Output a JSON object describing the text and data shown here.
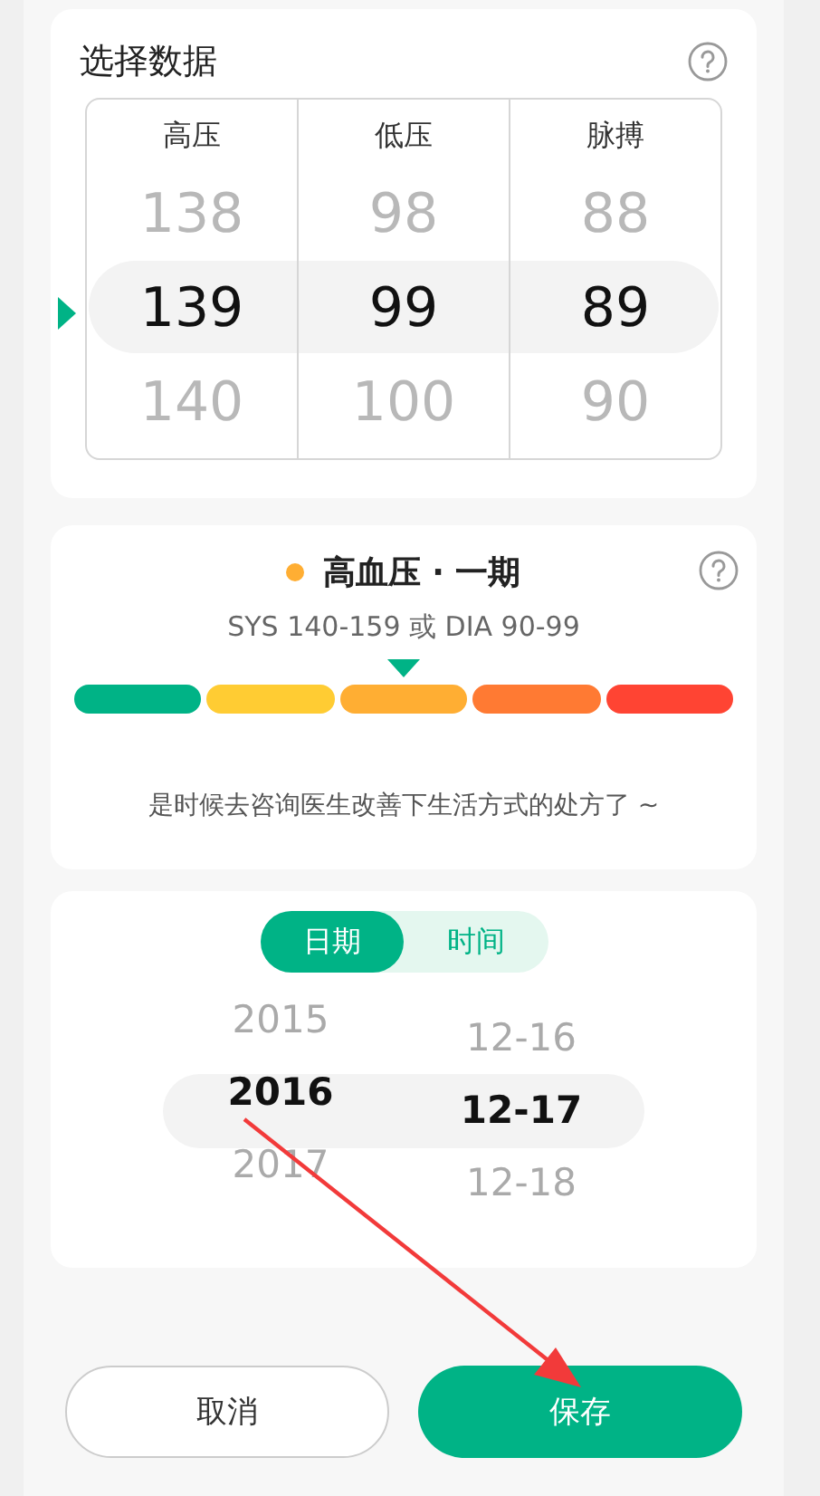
{
  "data_card": {
    "title": "选择数据",
    "columns": [
      {
        "label": "高压",
        "values": [
          {
            "text": "138",
            "selected": false
          },
          {
            "text": "139",
            "selected": true
          },
          {
            "text": "140",
            "selected": false
          }
        ]
      },
      {
        "label": "低压",
        "values": [
          {
            "text": "98",
            "selected": false
          },
          {
            "text": "99",
            "selected": true
          },
          {
            "text": "100",
            "selected": false
          }
        ]
      },
      {
        "label": "脉搏",
        "values": [
          {
            "text": "88",
            "selected": false
          },
          {
            "text": "89",
            "selected": true
          },
          {
            "text": "90",
            "selected": false
          }
        ]
      }
    ]
  },
  "result": {
    "title": "高血压 · 一期",
    "color": "#ffae33",
    "range": "SYS 140-159 或 DIA 90-99",
    "segments": [
      {
        "color": "#00b386",
        "selected": false
      },
      {
        "color": "#ffcc33",
        "selected": false
      },
      {
        "color": "#ffae33",
        "selected": true
      },
      {
        "color": "#ff7a33",
        "selected": false
      },
      {
        "color": "#ff4433",
        "selected": false
      }
    ],
    "advice": "是时候去咨询医生改善下生活方式的处方了 ~"
  },
  "datetime": {
    "tabs": [
      {
        "label": "日期",
        "selected": true
      },
      {
        "label": "时间",
        "selected": false
      }
    ],
    "columns": [
      {
        "kind": "year",
        "values": [
          {
            "text": "2015",
            "selected": false
          },
          {
            "text": "2016",
            "selected": true
          },
          {
            "text": "2017",
            "selected": false
          }
        ]
      },
      {
        "kind": "date",
        "values": [
          {
            "text": "12-16",
            "selected": false
          },
          {
            "text": "12-17",
            "selected": true
          },
          {
            "text": "12-18",
            "selected": false
          }
        ]
      }
    ]
  },
  "buttons": [
    {
      "label": "取消",
      "kind": "secondary"
    },
    {
      "label": "保存",
      "kind": "primary"
    }
  ]
}
